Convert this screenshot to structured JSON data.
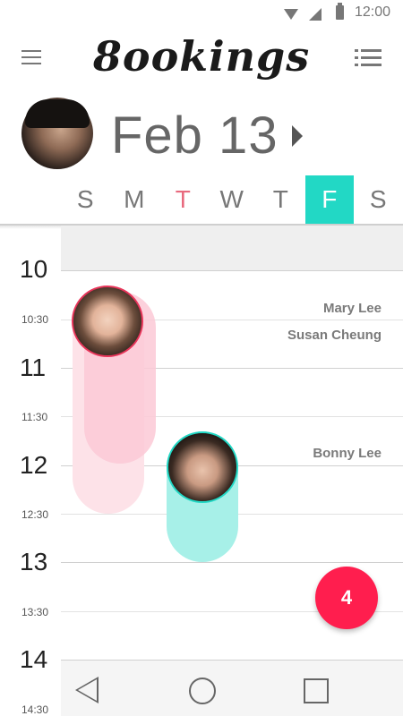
{
  "status_bar": {
    "time": "12:00",
    "icons": [
      "wifi-icon",
      "signal-icon",
      "battery-icon"
    ]
  },
  "header": {
    "title": "8ookings",
    "menu_icon": "hamburger-menu-icon",
    "list_icon": "list-view-icon"
  },
  "date_row": {
    "date": "Feb 13",
    "next_icon": "chevron-right-icon"
  },
  "weekdays": [
    {
      "label": "S"
    },
    {
      "label": "M"
    },
    {
      "label": "T",
      "state": "today"
    },
    {
      "label": "W"
    },
    {
      "label": "T"
    },
    {
      "label": "F",
      "state": "selected"
    },
    {
      "label": "S"
    }
  ],
  "timeline": {
    "hours": [
      "10",
      "11",
      "12",
      "13",
      "14"
    ],
    "half_hours": [
      "10:30",
      "11:30",
      "12:30",
      "13:30",
      "14:30"
    ]
  },
  "events": [
    {
      "name": "Mary Lee",
      "accent": "#e8355a"
    },
    {
      "name": "Susan Cheung",
      "accent": "#f8bccb"
    },
    {
      "name": "Bonny Lee",
      "accent": "#22d8c5"
    }
  ],
  "fab": {
    "label": "4"
  },
  "colors": {
    "selected_day": "#22d8c5",
    "today_text": "#e86a7e",
    "fab": "#ff1e4e"
  },
  "nav": {
    "icons": [
      "back-icon",
      "home-icon",
      "recents-icon"
    ]
  }
}
